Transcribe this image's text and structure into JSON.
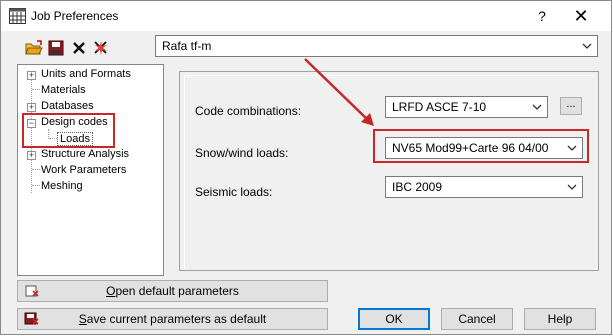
{
  "window": {
    "title": "Job Preferences",
    "help_label": "?",
    "close_label": "✕"
  },
  "toolbar": {
    "icons": [
      "open-folder-icon",
      "save-icon",
      "delete-icon",
      "reset-icon"
    ]
  },
  "preset": {
    "value": "Rafa tf-m"
  },
  "tree": {
    "items": [
      {
        "label": "Units and Formats",
        "expander": "+"
      },
      {
        "label": "Materials",
        "expander": ""
      },
      {
        "label": "Databases",
        "expander": "+"
      },
      {
        "label": "Design codes",
        "expander": "−"
      },
      {
        "label": "Loads",
        "expander": ""
      },
      {
        "label": "Structure Analysis",
        "expander": "+"
      },
      {
        "label": "Work Parameters",
        "expander": ""
      },
      {
        "label": "Meshing",
        "expander": ""
      }
    ]
  },
  "fields": {
    "code_combinations": {
      "label": "Code combinations:",
      "value": "LRFD ASCE 7-10",
      "button": "..."
    },
    "snow_wind": {
      "label": "Snow/wind loads:",
      "value": "NV65 Mod99+Carte 96 04/00"
    },
    "seismic": {
      "label": "Seismic loads:",
      "value": "IBC 2009"
    }
  },
  "buttons": {
    "open_default_first": "O",
    "open_default_rest": "pen default parameters",
    "save_default_first": "S",
    "save_default_rest": "ave current parameters as default",
    "ok": "OK",
    "cancel": "Cancel",
    "help": "Help"
  },
  "colors": {
    "annotation_red": "#c62828",
    "window_bg": "#f0f0f0"
  }
}
